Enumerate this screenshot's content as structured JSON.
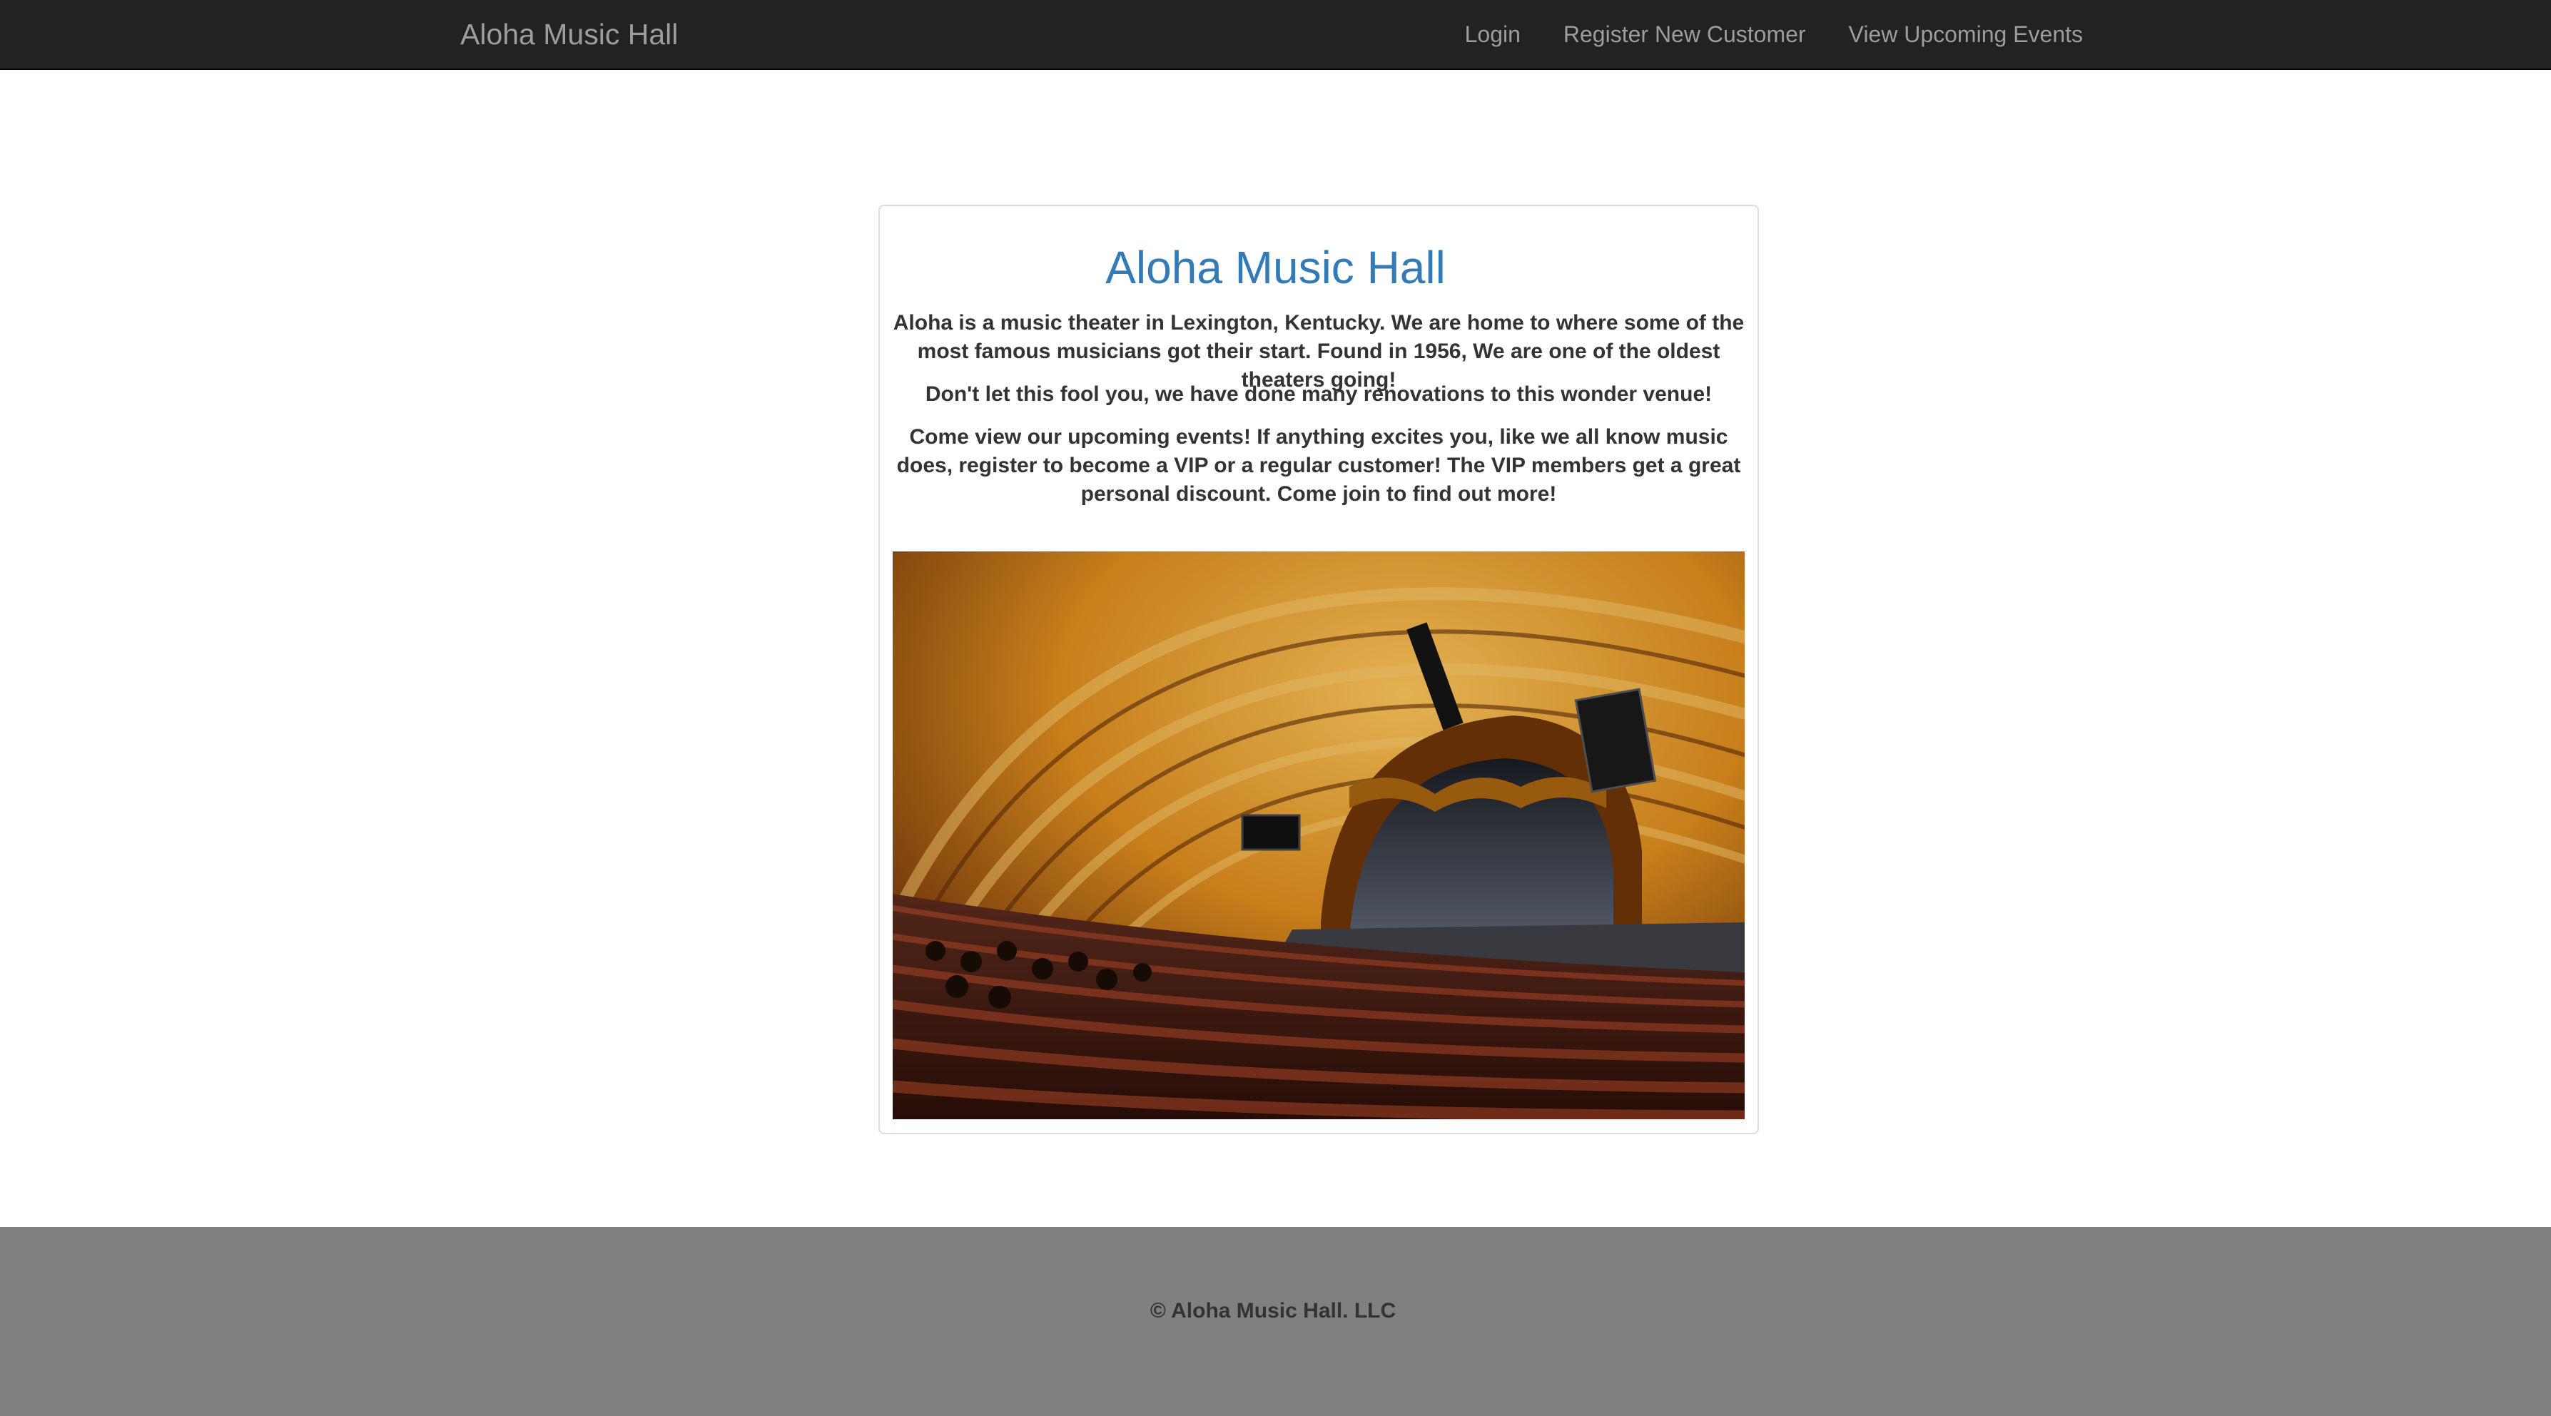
{
  "navbar": {
    "brand": "Aloha Music Hall",
    "links": {
      "login": "Login",
      "register": "Register New Customer",
      "events": "View Upcoming Events"
    }
  },
  "main": {
    "title": "Aloha Music Hall",
    "paragraphs": [
      "Aloha is a music theater in Lexington, Kentucky. We are home to where some of the most famous musicians got their start. Found in 1956, We are one of the oldest theaters going!",
      "Don't let this fool you, we have done many renovations to this wonder venue!",
      "Come view our upcoming events! If anything excites you, like we all know music does, register to become a VIP or a regular customer! The VIP members get a great personal discount. Come join to find out more!"
    ]
  },
  "footer": {
    "copyright": "© Aloha Music Hall. LLC"
  },
  "colors": {
    "navbar_bg": "#222222",
    "nav_text": "#9d9d9d",
    "title_blue": "#337ab7",
    "footer_bg": "#808080",
    "body_text": "#333333"
  }
}
